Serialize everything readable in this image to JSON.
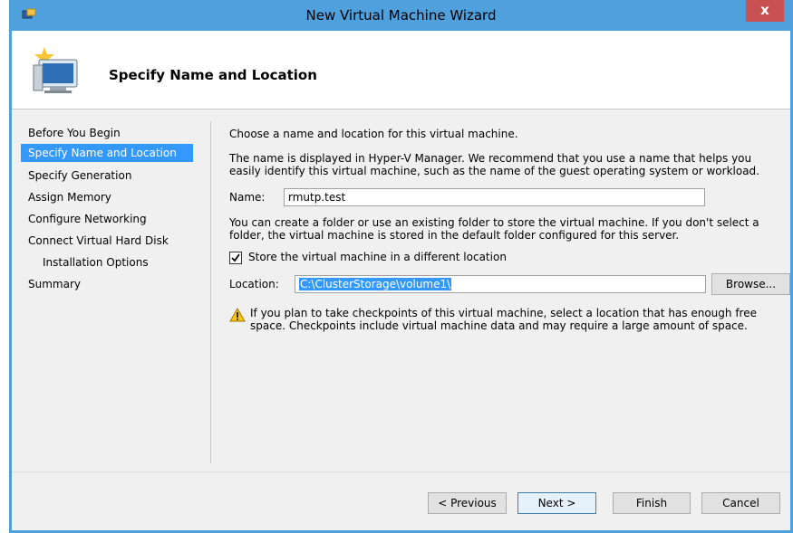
{
  "window": {
    "title": "New Virtual Machine Wizard",
    "close_glyph": "x"
  },
  "header": {
    "title": "Specify Name and Location",
    "icon": "wizard-computer-icon"
  },
  "nav": {
    "items": [
      {
        "label": "Before You Begin"
      },
      {
        "label": "Specify Name and Location"
      },
      {
        "label": "Specify Generation"
      },
      {
        "label": "Assign Memory"
      },
      {
        "label": "Configure Networking"
      },
      {
        "label": "Connect Virtual Hard Disk"
      },
      {
        "label": "Installation Options"
      },
      {
        "label": "Summary"
      }
    ]
  },
  "content": {
    "intro": "Choose a name and location for this virtual machine.",
    "name_help": "The name is displayed in Hyper-V Manager. We recommend that you use a name that helps you easily identify this virtual machine, such as the name of the guest operating system or workload.",
    "name_label": "Name:",
    "name_value": "rmutp.test",
    "folder_help": "You can create a folder or use an existing folder to store the virtual machine. If you don't select a folder, the virtual machine is stored in the default folder configured for this server.",
    "store_checkbox_label": "Store the virtual machine in a different location",
    "store_checked": true,
    "location_label": "Location:",
    "location_value": "C:\\ClusterStorage\\volume1\\",
    "browse_label": "Browse...",
    "warning_text": "If you plan to take checkpoints of this virtual machine, select a location that has enough free space. Checkpoints include virtual machine data and may require a large amount of space."
  },
  "footer": {
    "previous_label": "< Previous",
    "next_label": "Next >",
    "finish_label": "Finish",
    "cancel_label": "Cancel"
  },
  "colors": {
    "titlebar": "#4fa0dd",
    "selection": "#3399ff",
    "close": "#c75050"
  }
}
